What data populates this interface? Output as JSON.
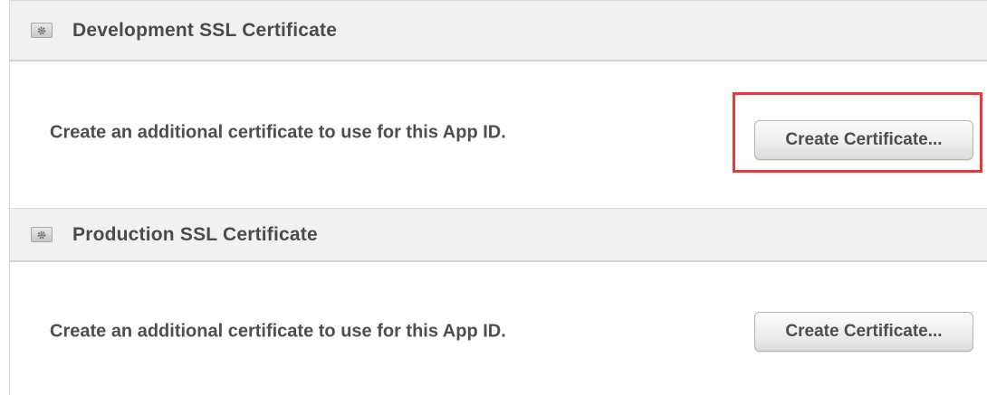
{
  "sections": [
    {
      "title": "Development SSL Certificate",
      "icon": "certificate-gear-icon",
      "description": "Create an additional certificate to use for this App ID.",
      "button_label": "Create Certificate...",
      "highlighted": true
    },
    {
      "title": "Production SSL Certificate",
      "icon": "certificate-gear-icon",
      "description": "Create an additional certificate to use for this App ID.",
      "button_label": "Create Certificate...",
      "highlighted": false
    }
  ],
  "colors": {
    "highlight": "#e8383a",
    "header_background": "#f1f1f1",
    "text": "#4a4a4a"
  }
}
